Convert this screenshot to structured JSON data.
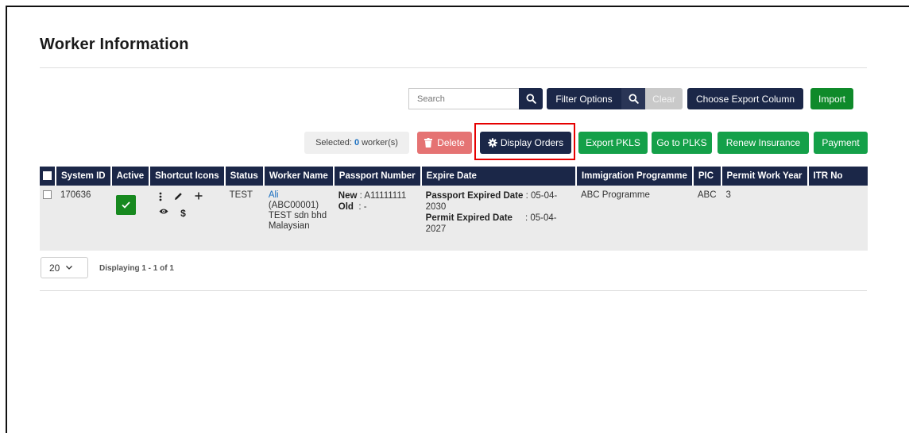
{
  "page": {
    "title": "Worker Information"
  },
  "search": {
    "placeholder": "Search",
    "icon": "search-icon"
  },
  "toolbar": {
    "filter_options": "Filter Options",
    "clear": "Clear",
    "choose_export_column": "Choose Export Column",
    "import": "Import"
  },
  "actions": {
    "selected_prefix": "Selected:",
    "selected_count": "0",
    "selected_suffix": "worker(s)",
    "delete": "Delete",
    "display_orders": "Display Orders",
    "export_pkls": "Export PKLS",
    "go_to_plks": "Go to PLKS",
    "renew_insurance": "Renew Insurance",
    "payment": "Payment"
  },
  "table": {
    "headers": [
      "System ID",
      "Active",
      "Shortcut Icons",
      "Status",
      "Worker Name",
      "Passport Number",
      "Expire Date",
      "Immigration Programme",
      "PIC",
      "Permit Work Year",
      "ITR No"
    ],
    "rows": [
      {
        "system_id": "170636",
        "status": "TEST",
        "worker_name_link": "Ali",
        "worker_code": "(ABC00001)",
        "company": "TEST sdn bhd",
        "nationality": "Malaysian",
        "passport_new_label": "New",
        "passport_new": ": A11111111",
        "passport_old_label": "Old",
        "passport_old": ": -",
        "passport_expired_label": "Passport Expired Date",
        "passport_expired": ": 05-04-2030",
        "permit_expired_label": "Permit Expired Date",
        "permit_expired": ": 05-04-2027",
        "immigration_programme": "ABC Programme",
        "pic": "ABC",
        "permit_work_year": "3",
        "itr_no": ""
      }
    ]
  },
  "pagination": {
    "page_size": "20",
    "displaying": "Displaying 1 - 1 of 1"
  },
  "colors": {
    "navy": "#1b2748",
    "green": "#0f8a2a",
    "delete_red": "#e57373",
    "highlight": "#e60000",
    "link": "#1a6fc0"
  }
}
